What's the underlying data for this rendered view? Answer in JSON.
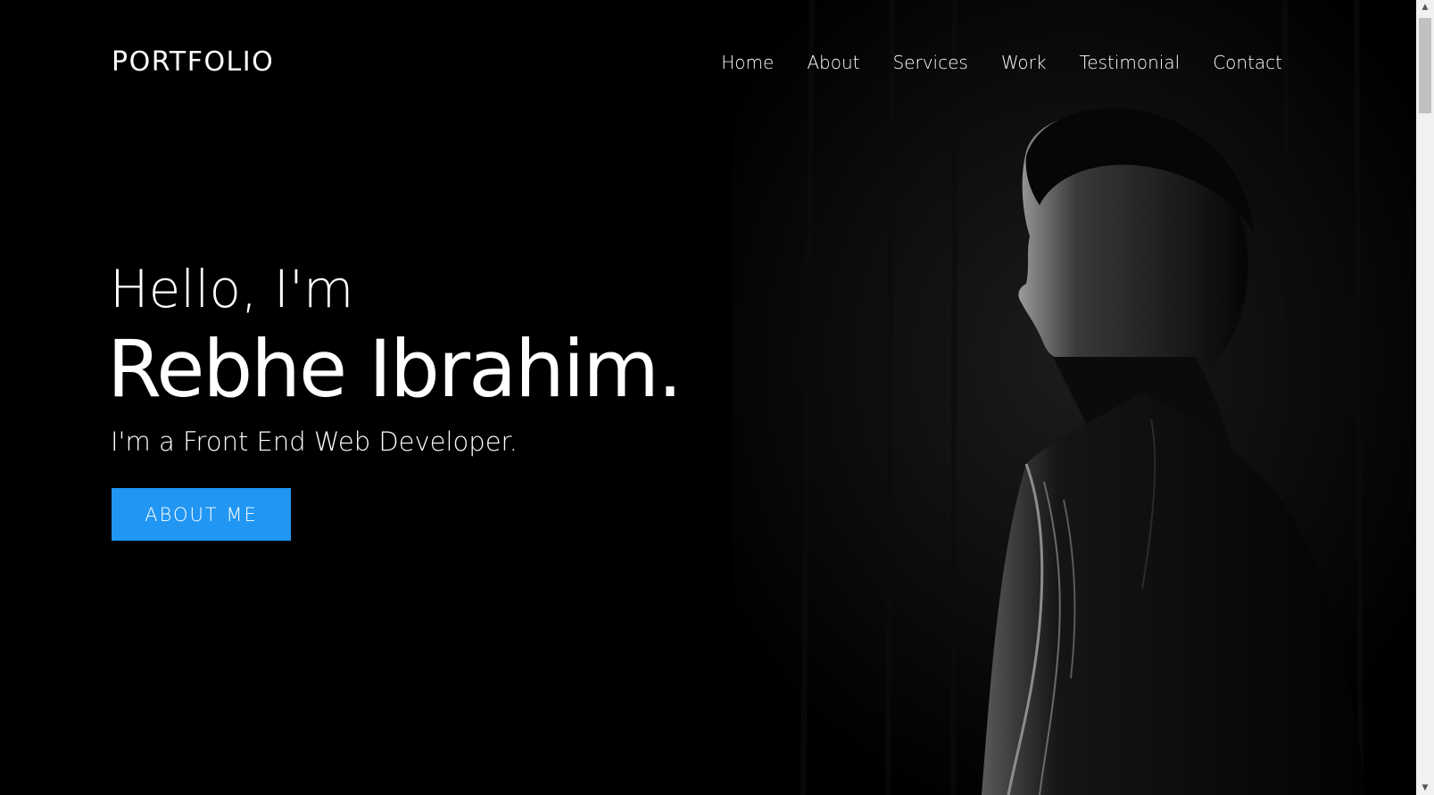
{
  "header": {
    "brand": "PORTFOLIO",
    "nav": [
      "Home",
      "About",
      "Services",
      "Work",
      "Testimonial",
      "Contact"
    ]
  },
  "hero": {
    "greeting": "Hello, I'm",
    "name": "Rebhe Ibrahim.",
    "role": "I'm a Front End Web Developer.",
    "button_label": "ABOUT ME"
  },
  "colors": {
    "background": "#000000",
    "accent": "#2196f3",
    "text": "#ffffff"
  },
  "scrollbar": {
    "up_icon": "triangle-up-icon",
    "down_icon": "triangle-down-icon"
  }
}
